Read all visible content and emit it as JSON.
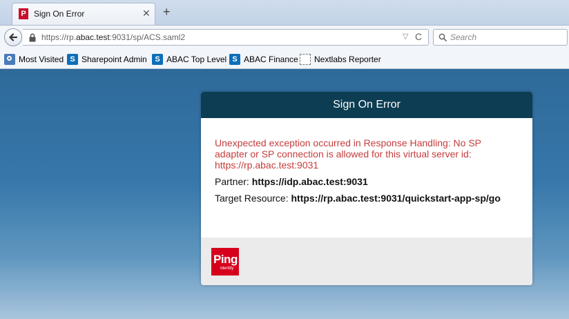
{
  "browser": {
    "tab": {
      "title": "Sign On Error",
      "close": "✕",
      "new_tab": "+"
    },
    "address": {
      "prefix": "https://rp.",
      "host": "abac.test",
      "suffix": ":9031/sp/ACS.saml2",
      "dropdown": "▽",
      "reload": "C"
    },
    "search": {
      "placeholder": "Search"
    },
    "bookmarks": [
      {
        "label": "Most Visited"
      },
      {
        "label": "Sharepoint Admin"
      },
      {
        "label": "ABAC Top Level"
      },
      {
        "label": "ABAC Finance"
      },
      {
        "label": "Nextlabs Reporter"
      }
    ]
  },
  "card": {
    "title": "Sign On Error",
    "error": "Unexpected exception occurred in Response Handling: No SP adapter or SP connection is allowed for this virtual server id: https://rp.abac.test:9031",
    "partner_label": "Partner: ",
    "partner_value": "https://idp.abac.test:9031",
    "target_label": "Target Resource: ",
    "target_value": "https://rp.abac.test:9031/quickstart-app-sp/go",
    "logo_word": "Ping",
    "logo_sub": "Identity"
  },
  "colors": {
    "header": "#0d3d52",
    "error_text": "#c43c3c",
    "logo": "#d6001c"
  }
}
